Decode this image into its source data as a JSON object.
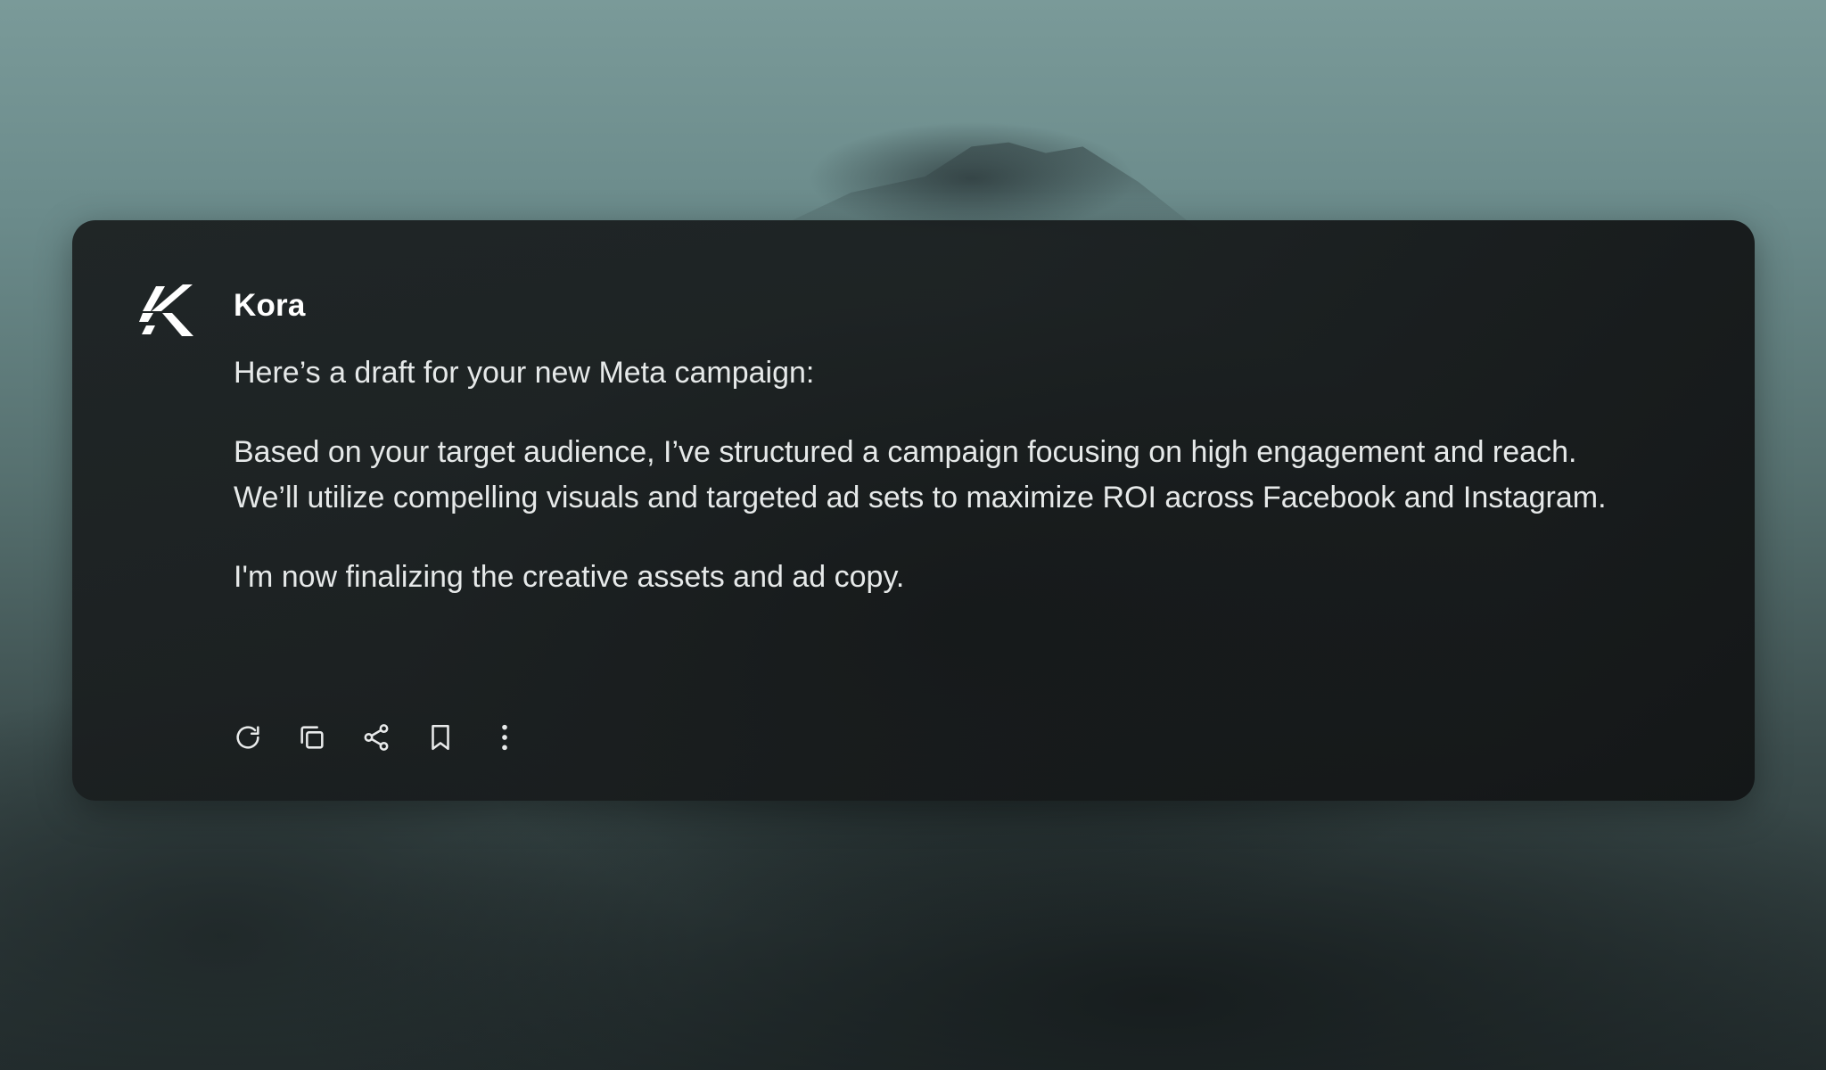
{
  "message": {
    "sender": "Kora",
    "intro": "Here’s a draft for your new Meta campaign:",
    "body": "Based on your target audience, I’ve structured a campaign focusing on high engagement and reach. We’ll utilize compelling visuals and targeted ad sets to maximize ROI across Facebook and Instagram.",
    "status": "I'm now finalizing the creative assets and ad copy."
  },
  "actions": [
    {
      "icon": "regenerate-icon"
    },
    {
      "icon": "copy-icon"
    },
    {
      "icon": "share-icon"
    },
    {
      "icon": "bookmark-icon"
    },
    {
      "icon": "more-vertical-icon"
    }
  ],
  "colors": {
    "card_background": "#1a1e1f",
    "text_primary": "#ffffff",
    "text_body": "#e6e9e9"
  }
}
